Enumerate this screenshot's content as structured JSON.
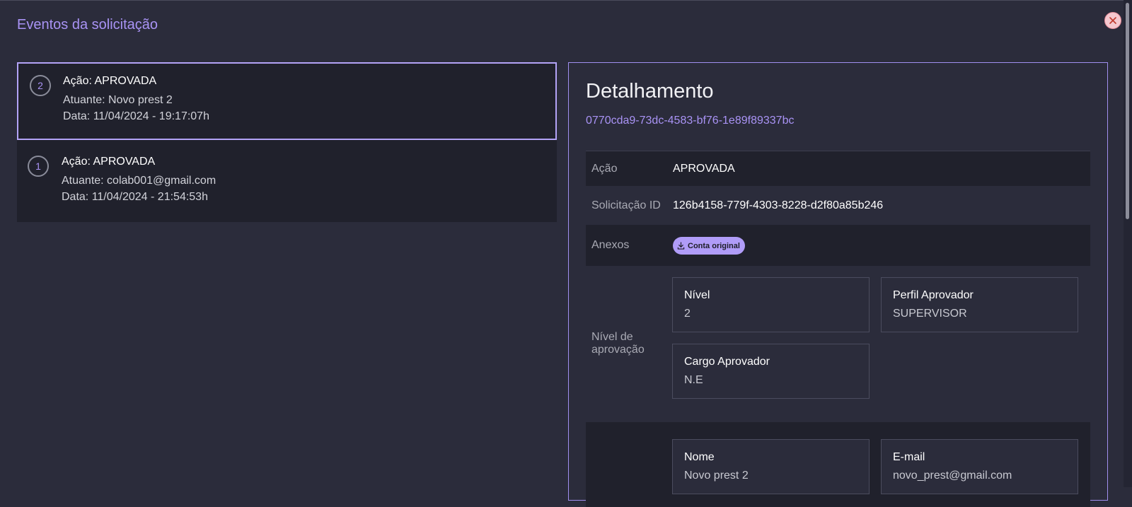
{
  "modal": {
    "title": "Eventos da solicitação"
  },
  "events": [
    {
      "index": "2",
      "action": "Ação: APROVADA",
      "actor": "Atuante: Novo prest 2",
      "date": "Data: 11/04/2024 - 19:17:07h"
    },
    {
      "index": "1",
      "action": "Ação: APROVADA",
      "actor": "Atuante: colab001@gmail.com",
      "date": "Data: 11/04/2024 - 21:54:53h"
    }
  ],
  "detail": {
    "title": "Detalhamento",
    "id": "0770cda9-73dc-4583-bf76-1e89f89337bc",
    "action_label": "Ação",
    "action_value": "APROVADA",
    "request_label": "Solicitação ID",
    "request_value": "126b4158-779f-4303-8228-d2f80a85b246",
    "attachments_label": "Anexos",
    "attachment_button": "Conta original",
    "approval_label": "Nível de aprovação",
    "approval_cards": [
      {
        "title": "Nível",
        "value": "2"
      },
      {
        "title": "Perfil Aprovador",
        "value": "SUPERVISOR"
      },
      {
        "title": "Cargo Aprovador",
        "value": "N.E"
      }
    ],
    "approver_cards": [
      {
        "title": "Nome",
        "value": "Novo prest 2"
      },
      {
        "title": "E-mail",
        "value": "novo_prest@gmail.com"
      }
    ]
  },
  "colors": {
    "accent": "#a993f5",
    "panel": "#20212c",
    "background": "#2b2c3b"
  },
  "icons": {
    "close": "close-icon",
    "download": "download-icon"
  }
}
